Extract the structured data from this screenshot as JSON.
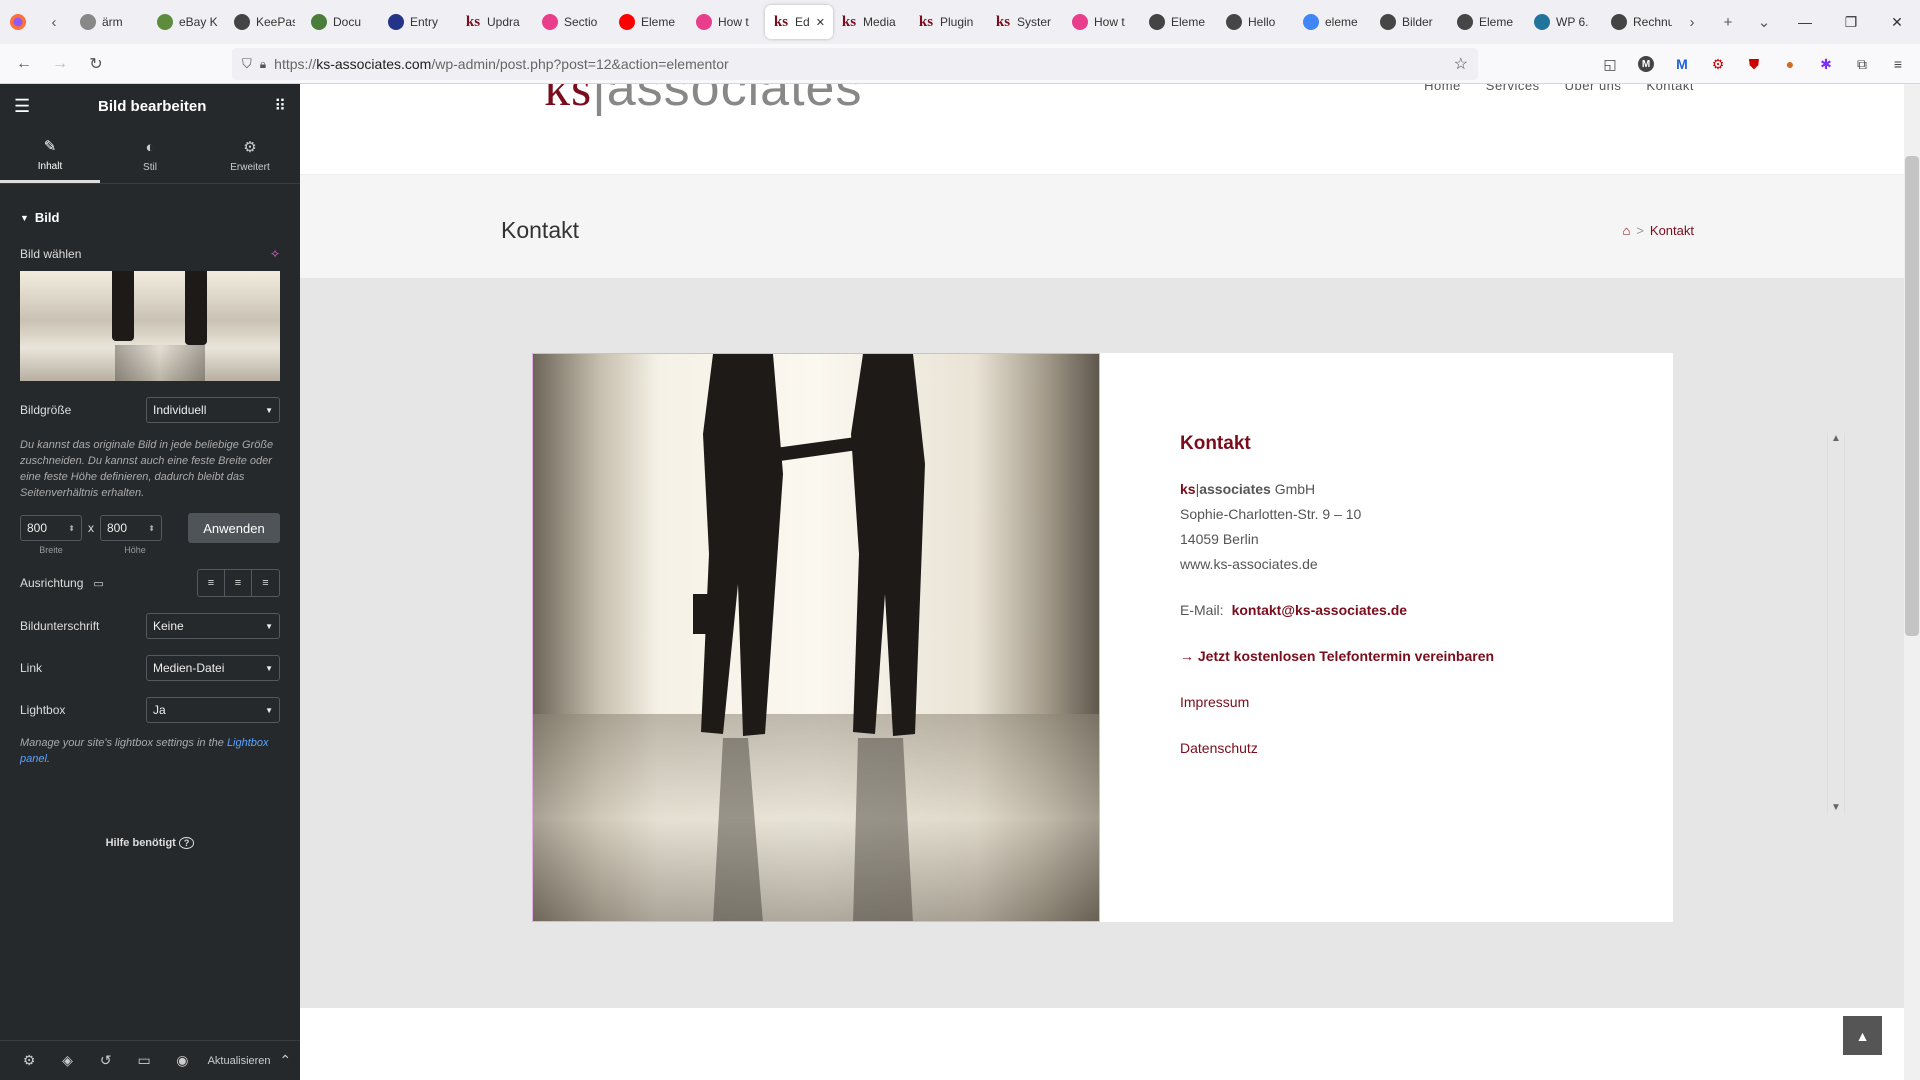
{
  "browser": {
    "tabs": [
      {
        "icon": "cart-icon",
        "label": "ärm",
        "color": "#888"
      },
      {
        "icon": "ebay-icon",
        "label": "eBay K",
        "color": "#5c8c3c"
      },
      {
        "icon": "keepass-icon",
        "label": "KeePassXC",
        "color": "#444"
      },
      {
        "icon": "docs-icon",
        "label": "Docu",
        "color": "#4a7d3a"
      },
      {
        "icon": "entry-icon",
        "label": "Entry",
        "color": "#223388"
      },
      {
        "icon": "ks-icon",
        "label": "Updra",
        "color": "#7a0c1c",
        "text": "ks"
      },
      {
        "icon": "elementor-icon",
        "label": "Sectio",
        "color": "#e83e8c"
      },
      {
        "icon": "youtube-icon",
        "label": "Eleme",
        "color": "#ff0000"
      },
      {
        "icon": "elementor-icon",
        "label": "How t",
        "color": "#e83e8c"
      },
      {
        "icon": "ks-icon",
        "label": "Edi",
        "color": "#7a0c1c",
        "text": "ks",
        "active": true
      },
      {
        "icon": "ks-icon",
        "label": "Media",
        "color": "#7a0c1c",
        "text": "ks"
      },
      {
        "icon": "ks-icon",
        "label": "Plugin",
        "color": "#7a0c1c",
        "text": "ks"
      },
      {
        "icon": "ks-icon",
        "label": "Syster",
        "color": "#7a0c1c",
        "text": "ks"
      },
      {
        "icon": "elementor-icon",
        "label": "How t",
        "color": "#e83e8c"
      },
      {
        "icon": "elementor-doc-icon",
        "label": "Eleme",
        "color": "#444"
      },
      {
        "icon": "wordpress-icon",
        "label": "Hello",
        "color": "#464646"
      },
      {
        "icon": "google-icon",
        "label": "eleme",
        "color": "#4285f4"
      },
      {
        "icon": "wordpress-icon",
        "label": "Bilder",
        "color": "#464646"
      },
      {
        "icon": "wordpress-icon",
        "label": "Eleme",
        "color": "#464646"
      },
      {
        "icon": "wordpress-icon",
        "label": "WP 6.",
        "color": "#21759b"
      },
      {
        "icon": "invoice-icon",
        "label": "Rechnung",
        "color": "#444"
      }
    ],
    "url_prefix": "https://",
    "url_host": "ks-associates.com",
    "url_path": "/wp-admin/post.php?post=12&action=elementor"
  },
  "panel": {
    "title": "Bild bearbeiten",
    "tabs": {
      "content": "Inhalt",
      "style": "Stil",
      "advanced": "Erweitert"
    },
    "section_title": "Bild",
    "choose_label": "Bild wählen",
    "size_label": "Bildgröße",
    "size_value": "Individuell",
    "size_help": "Du kannst das originale Bild in jede beliebige Größe zuschneiden. Du kannst auch eine feste Breite oder eine feste Höhe definieren, dadurch bleibt das Seitenverhältnis erhalten.",
    "width_value": "800",
    "height_value": "800",
    "x_sep": "x",
    "width_label": "Breite",
    "height_label": "Höhe",
    "apply_label": "Anwenden",
    "align_label": "Ausrichtung",
    "caption_label": "Bildunterschrift",
    "caption_value": "Keine",
    "link_label": "Link",
    "link_value": "Medien-Datei",
    "lightbox_label": "Lightbox",
    "lightbox_value": "Ja",
    "lightbox_help": "Manage your site's lightbox settings in the ",
    "lightbox_link": "Lightbox panel",
    "lightbox_help_end": ".",
    "need_help": "Hilfe benötigt",
    "update_label": "Aktualisieren"
  },
  "site": {
    "logo_ks": "ks",
    "logo_sep": "|",
    "logo_assoc": "associates",
    "menu": [
      "Home",
      "Services",
      "Über uns",
      "Kontakt"
    ],
    "page_title": "Kontakt",
    "breadcrumb_sep": ">",
    "breadcrumb_current": "Kontakt",
    "contact": {
      "heading": "Kontakt",
      "company_ks": "ks",
      "company_sep": "|",
      "company_assoc": "associates",
      "company_suffix": " GmbH",
      "street": "Sophie-Charlotten-Str. 9 – 10",
      "city": "14059 Berlin",
      "web": "www.ks-associates.de",
      "email_label": "E-Mail:",
      "email": "kontakt@ks-associates.de",
      "cta_arrow": "→",
      "cta": "Jetzt kostenlosen Telefontermin vereinbaren",
      "impressum": "Impressum",
      "datenschutz": "Datenschutz"
    }
  },
  "colors": {
    "brand": "#7a0c1c",
    "panel_bg": "#26292c",
    "accent_link": "#5aa3ff"
  }
}
